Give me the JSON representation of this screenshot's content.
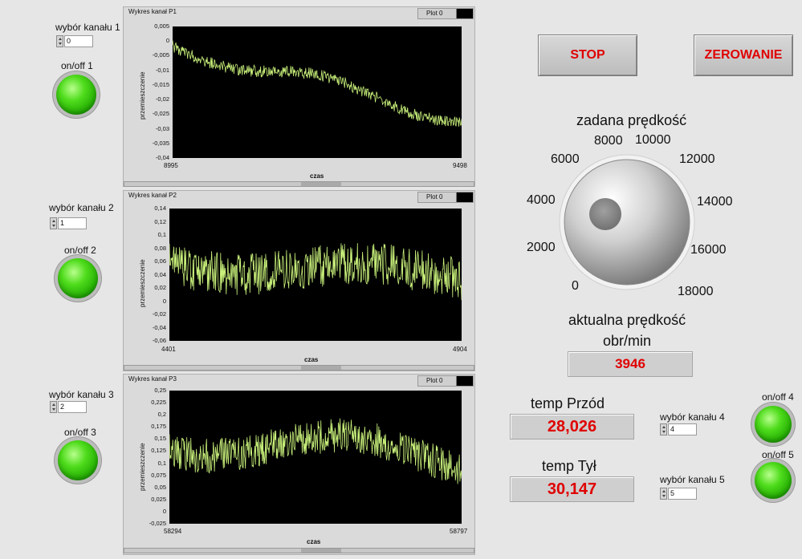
{
  "channels": [
    {
      "label": "wybór kanału 1",
      "value": "0",
      "onoff": "on/off 1"
    },
    {
      "label": "wybór kanału  2",
      "value": "1",
      "onoff": "on/off 2"
    },
    {
      "label": "wybór kanału  3",
      "value": "2",
      "onoff": "on/off 3"
    }
  ],
  "graphs": [
    {
      "title": "Wykres kanał P1",
      "legend": "Plot 0",
      "ylabel": "przemieszczenie",
      "xlabel": "czas",
      "yticks": [
        "0,005",
        "0",
        "-0,005",
        "-0,01",
        "-0,015",
        "-0,02",
        "-0,025",
        "-0,03",
        "-0,035",
        "-0,04"
      ],
      "xmin": "8995",
      "xmax": "9498"
    },
    {
      "title": "Wykres kanał P2",
      "legend": "Plot 0",
      "ylabel": "przemieszczenie",
      "xlabel": "czas",
      "yticks": [
        "0,14",
        "0,12",
        "0,1",
        "0,08",
        "0,06",
        "0,04",
        "0,02",
        "0",
        "-0,02",
        "-0,04",
        "-0,06"
      ],
      "xmin": "4401",
      "xmax": "4904"
    },
    {
      "title": "Wykres kanał P3",
      "legend": "Plot 0",
      "ylabel": "przemieszczenie",
      "xlabel": "czas",
      "yticks": [
        "0,25",
        "0,225",
        "0,2",
        "0,175",
        "0,15",
        "0,125",
        "0,1",
        "0,075",
        "0,05",
        "0,025",
        "0",
        "-0,025"
      ],
      "xmin": "58294",
      "xmax": "58797"
    }
  ],
  "buttons": {
    "stop": "STOP",
    "zero": "ZEROWANIE"
  },
  "knob": {
    "title": "zadana prędkość",
    "scale": [
      "0",
      "2000",
      "4000",
      "6000",
      "8000",
      "10000",
      "12000",
      "14000",
      "16000",
      "18000"
    ]
  },
  "speed": {
    "title": "aktualna prędkość",
    "unit": "obr/min",
    "value": "3946"
  },
  "temps": [
    {
      "label": "temp Przód",
      "value": "28,026"
    },
    {
      "label": "temp Tył",
      "value": "30,147"
    }
  ],
  "extra_channels": [
    {
      "label": "wybór kanału  4",
      "value": "4",
      "onoff": "on/off 4"
    },
    {
      "label": "wybór kanału  5",
      "value": "5",
      "onoff": "on/off 5"
    }
  ],
  "colors": {
    "trace": "#c8f07a",
    "led": "#3cd010",
    "accent_red": "#e00000",
    "plot_bg": "#000000"
  }
}
